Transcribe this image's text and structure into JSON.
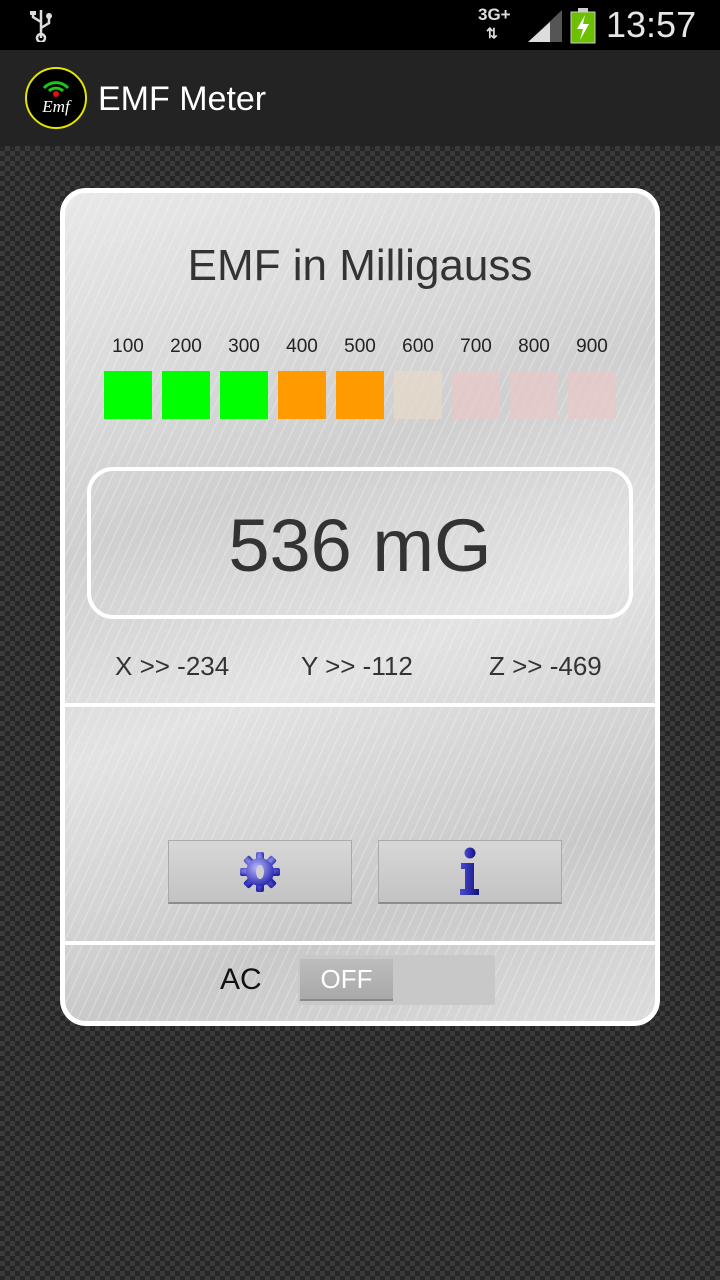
{
  "status_bar": {
    "network": "3G+",
    "time": "13:57",
    "icons": [
      "usb-icon",
      "signal-icon",
      "battery-charging-icon"
    ]
  },
  "action_bar": {
    "logo_text": "Emf",
    "title": "EMF Meter"
  },
  "meter": {
    "title": "EMF in Milligauss",
    "scale": [
      {
        "label": "100",
        "color": "#00ff00",
        "lit": true
      },
      {
        "label": "200",
        "color": "#00ff00",
        "lit": true
      },
      {
        "label": "300",
        "color": "#00ff00",
        "lit": true
      },
      {
        "label": "400",
        "color": "#ff9a00",
        "lit": true
      },
      {
        "label": "500",
        "color": "#ff9a00",
        "lit": true
      },
      {
        "label": "600",
        "color": "#e6d8c8",
        "lit": false
      },
      {
        "label": "700",
        "color": "#e8c8c8",
        "lit": false
      },
      {
        "label": "800",
        "color": "#e8c8c8",
        "lit": false
      },
      {
        "label": "900",
        "color": "#e8c8c8",
        "lit": false
      }
    ],
    "reading": "536 mG",
    "axes": {
      "x": "X >> -234",
      "y": "Y >> -112",
      "z": "Z >> -469"
    }
  },
  "buttons": {
    "settings_icon": "gear-icon",
    "info_icon": "info-icon"
  },
  "ac": {
    "label": "AC",
    "toggle_state": "OFF"
  }
}
